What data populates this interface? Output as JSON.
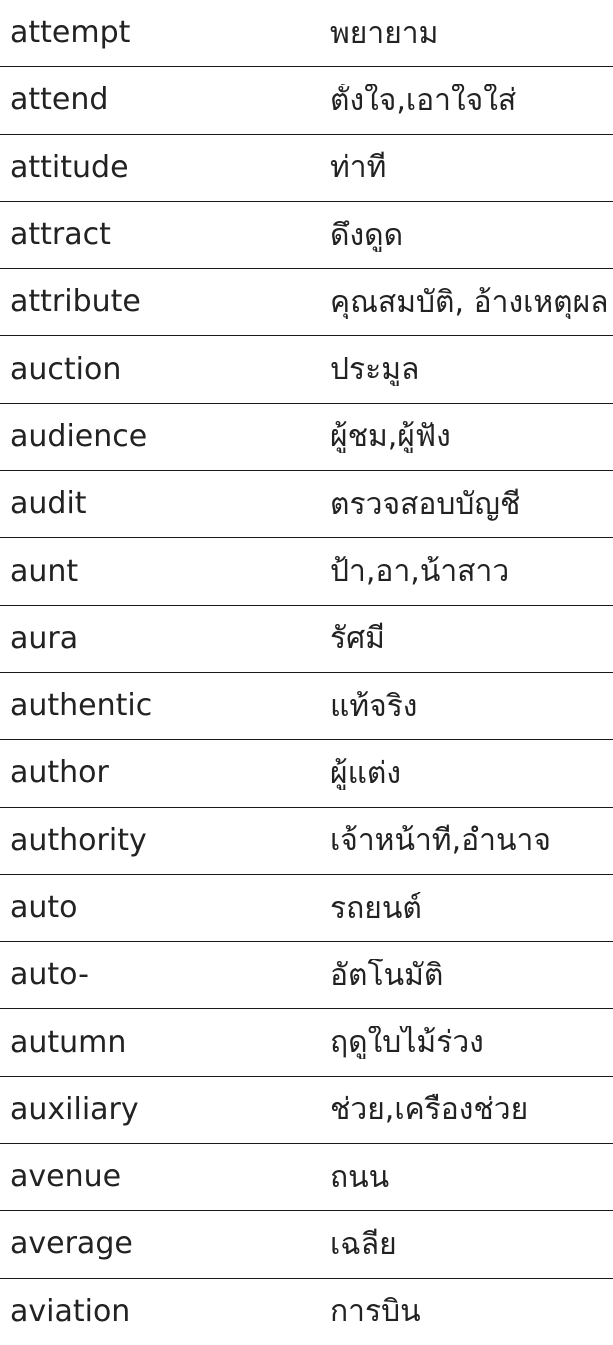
{
  "entries": [
    {
      "word": "attempt",
      "meaning": "พยายาม"
    },
    {
      "word": "attend",
      "meaning": "ตั้งใจ,เอาใจใส่"
    },
    {
      "word": "attitude",
      "meaning": "ท่าที"
    },
    {
      "word": "attract",
      "meaning": "ดึงดูด"
    },
    {
      "word": "attribute",
      "meaning": "คุณสมบัติ, อ้างเหตุผล"
    },
    {
      "word": "auction",
      "meaning": "ประมูล"
    },
    {
      "word": "audience",
      "meaning": "ผู้ชม,ผู้ฟัง"
    },
    {
      "word": "audit",
      "meaning": "ตรวจสอบบัญชี"
    },
    {
      "word": "aunt",
      "meaning": "ป้า,อา,น้าสาว"
    },
    {
      "word": "aura",
      "meaning": "รัศมี"
    },
    {
      "word": "authentic",
      "meaning": "แท้จริง"
    },
    {
      "word": "author",
      "meaning": "ผู้แต่ง"
    },
    {
      "word": "authority",
      "meaning": "เจ้าหน้าที่,อำนาจ"
    },
    {
      "word": "auto",
      "meaning": "รถยนต์"
    },
    {
      "word": "auto-",
      "meaning": "อัตโนมัติ"
    },
    {
      "word": "autumn",
      "meaning": "ฤดูใบไม้ร่วง"
    },
    {
      "word": "auxiliary",
      "meaning": "ช่วย,เครื่องช่วย"
    },
    {
      "word": "avenue",
      "meaning": "ถนน"
    },
    {
      "word": "average",
      "meaning": "เฉลี่ย"
    },
    {
      "word": "aviation",
      "meaning": "การบิน"
    }
  ]
}
